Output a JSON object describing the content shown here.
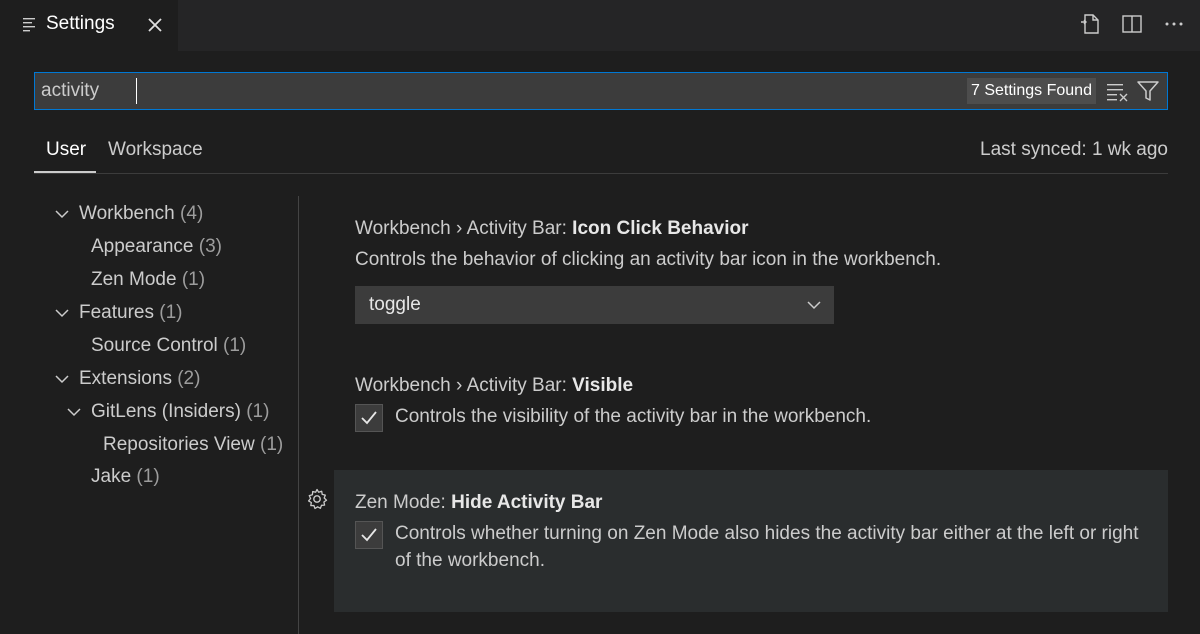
{
  "tab": {
    "title": "Settings"
  },
  "search": {
    "value": "activity",
    "results": "7 Settings Found"
  },
  "scopes": {
    "user": "User",
    "workspace": "Workspace",
    "last_synced": "Last synced: 1 wk ago"
  },
  "toc": [
    {
      "label": "Workbench",
      "count": "(4)"
    },
    {
      "label": "Appearance",
      "count": "(3)"
    },
    {
      "label": "Zen Mode",
      "count": "(1)"
    },
    {
      "label": "Features",
      "count": "(1)"
    },
    {
      "label": "Source Control",
      "count": "(1)"
    },
    {
      "label": "Extensions",
      "count": "(2)"
    },
    {
      "label": "GitLens (Insiders)",
      "count": "(1)"
    },
    {
      "label": "Repositories View",
      "count": "(1)"
    },
    {
      "label": "Jake",
      "count": "(1)"
    }
  ],
  "settings": [
    {
      "category": "Workbench › Activity Bar: ",
      "name": "Icon Click Behavior",
      "description": "Controls the behavior of clicking an activity bar icon in the workbench.",
      "value": "toggle"
    },
    {
      "category": "Workbench › Activity Bar: ",
      "name": "Visible",
      "description": "Controls the visibility of the activity bar in the workbench."
    },
    {
      "category": "Zen Mode: ",
      "name": "Hide Activity Bar",
      "description": "Controls whether turning on Zen Mode also hides the activity bar either at the left or right of the workbench."
    }
  ]
}
